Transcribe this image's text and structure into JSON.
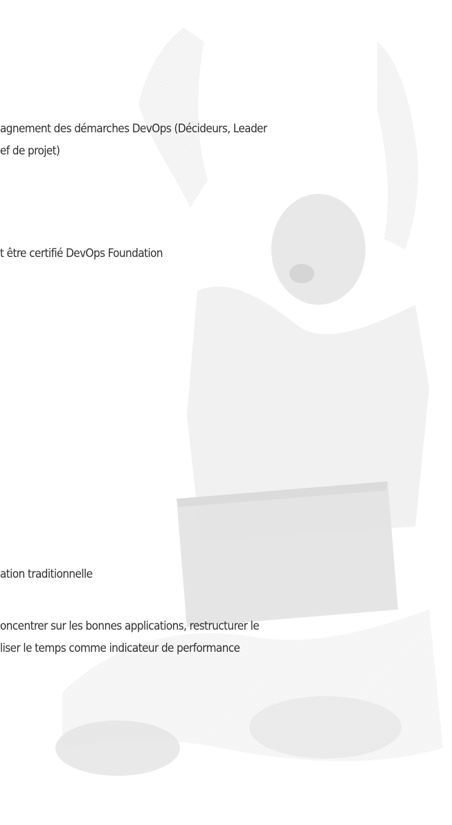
{
  "lines": {
    "line1": "agnement des démarches DevOps (Décideurs, Leader",
    "line2": "ef de projet)",
    "line3": "t être certifié DevOps Foundation",
    "line4": "ation traditionnelle",
    "line5": "oncentrer sur les bonnes applications, restructurer le",
    "line6": "liser le temps comme indicateur de performance"
  },
  "background": {
    "icon": "celebrating-person-with-laptop-photo",
    "tint": "#f2f2f2"
  }
}
